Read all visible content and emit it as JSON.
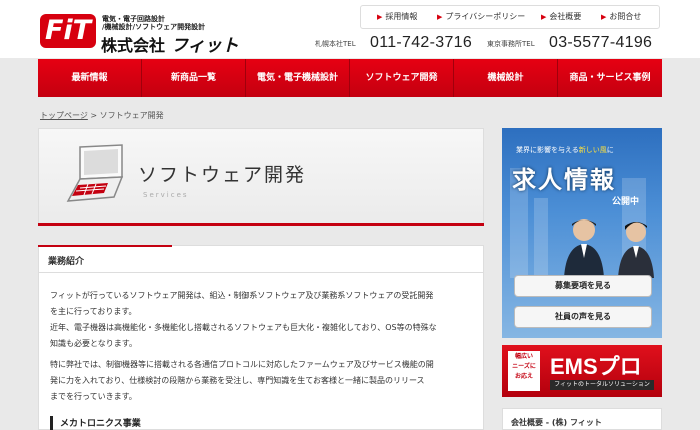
{
  "logo": {
    "mark": "FiT",
    "tag1": "電気・電子回路設計",
    "tag2": "/機械設計/ソフトウェア開発設計",
    "company": "株式会社",
    "company_name": "フィット"
  },
  "toplinks": [
    "採用情報",
    "プライバシーポリシー",
    "会社概要",
    "お問合せ"
  ],
  "tel": [
    {
      "label": "札幌本社TEL",
      "number": "011-742-3716"
    },
    {
      "label": "東京事務所TEL",
      "number": "03-5577-4196"
    }
  ],
  "nav": [
    "最新情報",
    "新商品一覧",
    "電気・電子機械設計",
    "ソフトウェア開発",
    "機械設計",
    "商品・サービス事例"
  ],
  "breadcrumb": {
    "home": "トップページ",
    "sep": ">",
    "current": "ソフトウェア開発"
  },
  "hero": {
    "title": "ソフトウェア開発",
    "subtitle": "Services"
  },
  "section": {
    "heading": "業務紹介",
    "para1_l1": "フィットが行っているソフトウェア開発は、組込・制御系ソフトウェア及び業務系ソフトウェアの受託開発",
    "para1_l2": "を主に行っております。",
    "para1_l3": "近年、電子機器は高機能化・多機能化し搭載されるソフトウェアも巨大化・複雑化しており、OS等の特殊な",
    "para1_l4": "知識も必要となります。",
    "para2_l1": "特に弊社では、制御機器等に搭載される各通信プロトコルに対応したファームウェア及びサービス機能の開",
    "para2_l2": "発に力を入れており、仕様検討の段階から業務を受注し、専門知識を生てお客様と一緒に製品のリリース",
    "para2_l3": "までを行っていきます。",
    "subheading": "メカトロニクス事業"
  },
  "recruit": {
    "tagline_pre": "業界に影響を与える",
    "tagline_hl": "新しい風",
    "tagline_post": "に",
    "title": "求人情報",
    "open": "公開中",
    "btn1": "募集要項を見る",
    "btn2": "社員の声を見る"
  },
  "ems": {
    "left": "幅広い\nニーズに\nお応え",
    "title": "EMSプロ",
    "sub": "フィットのトータルソリューション"
  },
  "side_box": {
    "title": "会社概要 - (株) フィット"
  },
  "colors": {
    "brand_red": "#d7000f",
    "banner_blue": "#2d6fbf"
  }
}
